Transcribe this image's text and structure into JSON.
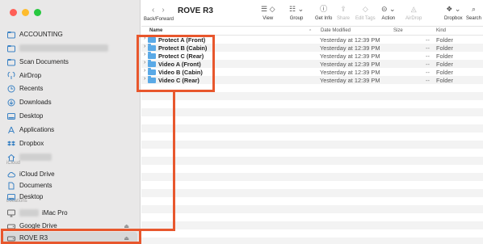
{
  "window": {
    "title": "ROVE R3",
    "traffic_colors": [
      "#ff5f57",
      "#febc2e",
      "#28c840"
    ]
  },
  "toolbar": {
    "back_forward_label": "Back/Forward",
    "buttons": [
      {
        "label": "View",
        "icon": "view-icon"
      },
      {
        "label": "Group",
        "icon": "group-icon"
      },
      {
        "label": "Get Info",
        "icon": "info-icon"
      },
      {
        "label": "Share",
        "icon": "share-icon"
      },
      {
        "label": "Edit Tags",
        "icon": "tag-icon"
      },
      {
        "label": "Action",
        "icon": "action-icon"
      },
      {
        "label": "AirDrop",
        "icon": "airdrop-icon"
      },
      {
        "label": "Dropbox",
        "icon": "dropbox-icon"
      },
      {
        "label": "Search",
        "icon": "search-icon"
      }
    ]
  },
  "columns": {
    "name": "Name",
    "date": "Date Modified",
    "size": "Size",
    "kind": "Kind"
  },
  "sidebar": {
    "favorites": [
      {
        "label": "ACCOUNTING",
        "icon": "folder-icon"
      },
      {
        "label": "",
        "icon": "folder-icon"
      },
      {
        "label": "Scan Documents",
        "icon": "folder-icon"
      },
      {
        "label": "AirDrop",
        "icon": "airdrop-icon"
      },
      {
        "label": "Recents",
        "icon": "clock-icon"
      },
      {
        "label": "Downloads",
        "icon": "download-icon"
      },
      {
        "label": "Desktop",
        "icon": "desktop-icon"
      },
      {
        "label": "Applications",
        "icon": "applications-icon"
      },
      {
        "label": "Dropbox",
        "icon": "dropbox-icon"
      },
      {
        "label": "",
        "icon": "home-icon"
      }
    ],
    "icloud_header": "iCloud",
    "icloud": [
      {
        "label": "iCloud Drive",
        "icon": "cloud-icon"
      },
      {
        "label": "Documents",
        "icon": "document-icon"
      },
      {
        "label": "Desktop",
        "icon": "desktop-icon"
      }
    ],
    "locations_header": "Locations",
    "locations": [
      {
        "label": "iMac Pro",
        "icon": "imac-icon"
      },
      {
        "label": "Google Drive",
        "icon": "drive-icon"
      },
      {
        "label": "ROVE R3",
        "icon": "disk-icon"
      }
    ]
  },
  "files": [
    {
      "name": "Protect A (Front)",
      "date": "Yesterday at 12:39 PM",
      "size": "--",
      "kind": "Folder"
    },
    {
      "name": "Protect B (Cabin)",
      "date": "Yesterday at 12:39 PM",
      "size": "--",
      "kind": "Folder"
    },
    {
      "name": "Protect C (Rear)",
      "date": "Yesterday at 12:39 PM",
      "size": "--",
      "kind": "Folder"
    },
    {
      "name": "Video A (Front)",
      "date": "Yesterday at 12:39 PM",
      "size": "--",
      "kind": "Folder"
    },
    {
      "name": "Video B (Cabin)",
      "date": "Yesterday at 12:39 PM",
      "size": "--",
      "kind": "Folder"
    },
    {
      "name": "Video C (Rear)",
      "date": "Yesterday at 12:39 PM",
      "size": "--",
      "kind": "Folder"
    }
  ],
  "annotation_color": "#e8572d"
}
